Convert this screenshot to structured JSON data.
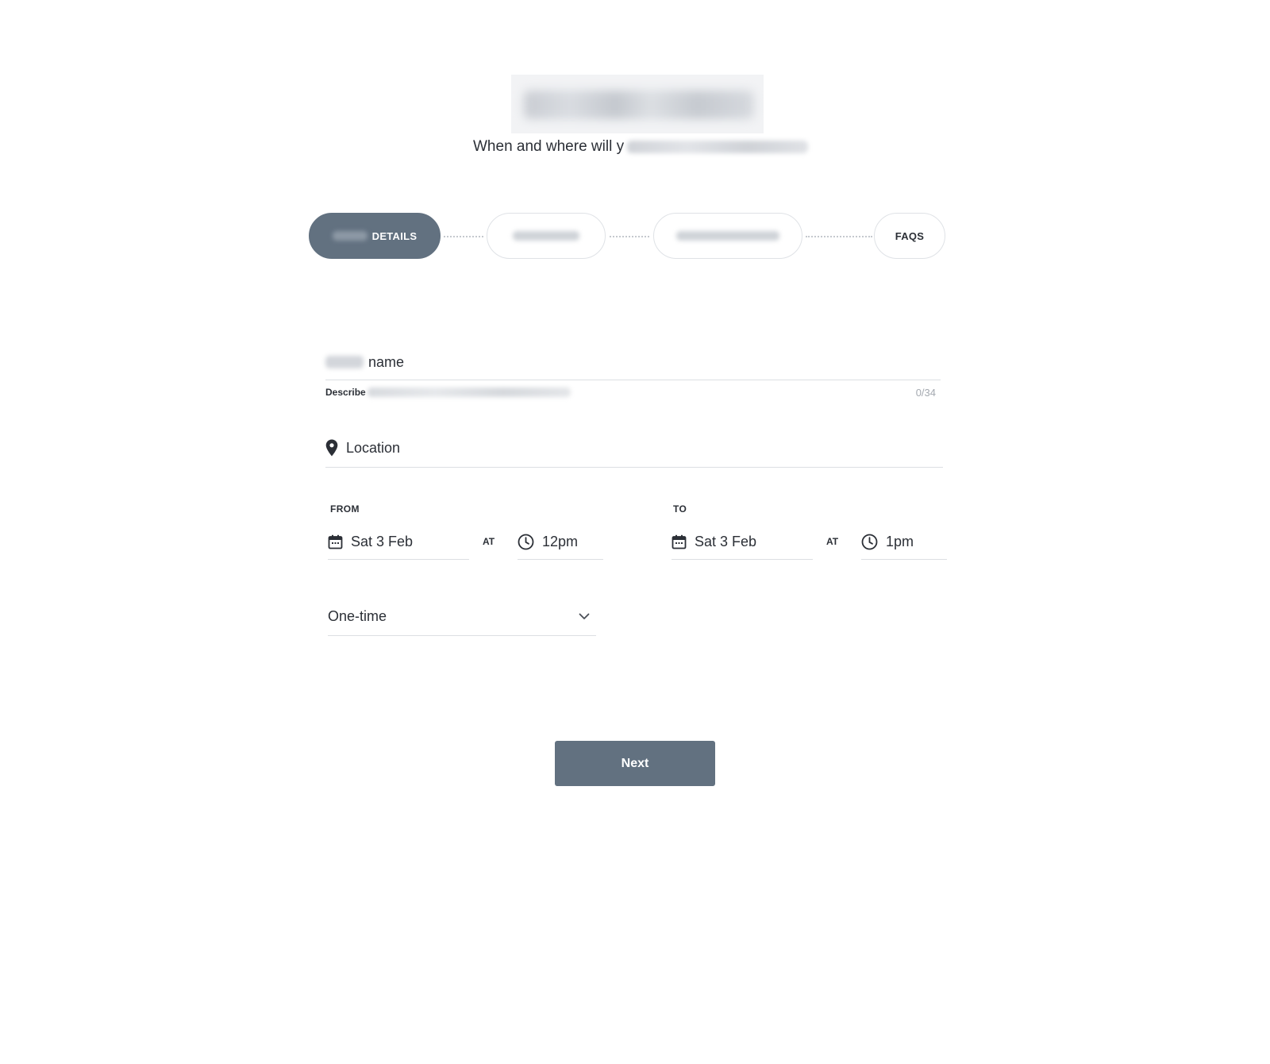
{
  "header": {
    "subtitle": "When and where will y"
  },
  "stepper": {
    "steps": [
      {
        "label": "DETAILS",
        "state": "active"
      },
      {
        "label": "",
        "state": "inactive"
      },
      {
        "label": "",
        "state": "inactive"
      },
      {
        "label": "FAQS",
        "state": "inactive"
      }
    ]
  },
  "form": {
    "name": {
      "label": "name",
      "helper": "Describe",
      "counter": "0/34"
    },
    "location": {
      "placeholder": "Location",
      "icon": "map-pin-icon"
    },
    "from": {
      "label": "FROM",
      "date": "Sat 3 Feb",
      "at": "AT",
      "time": "12pm"
    },
    "to": {
      "label": "TO",
      "date": "Sat 3 Feb",
      "at": "AT",
      "time": "1pm"
    },
    "recurrence": {
      "selected": "One-time",
      "icon": "chevron-down-icon"
    }
  },
  "actions": {
    "next_label": "Next"
  },
  "colors": {
    "accent": "#627180",
    "divider": "#dcdfe3",
    "text": "#2b2f36",
    "muted": "#a4a9b0"
  }
}
